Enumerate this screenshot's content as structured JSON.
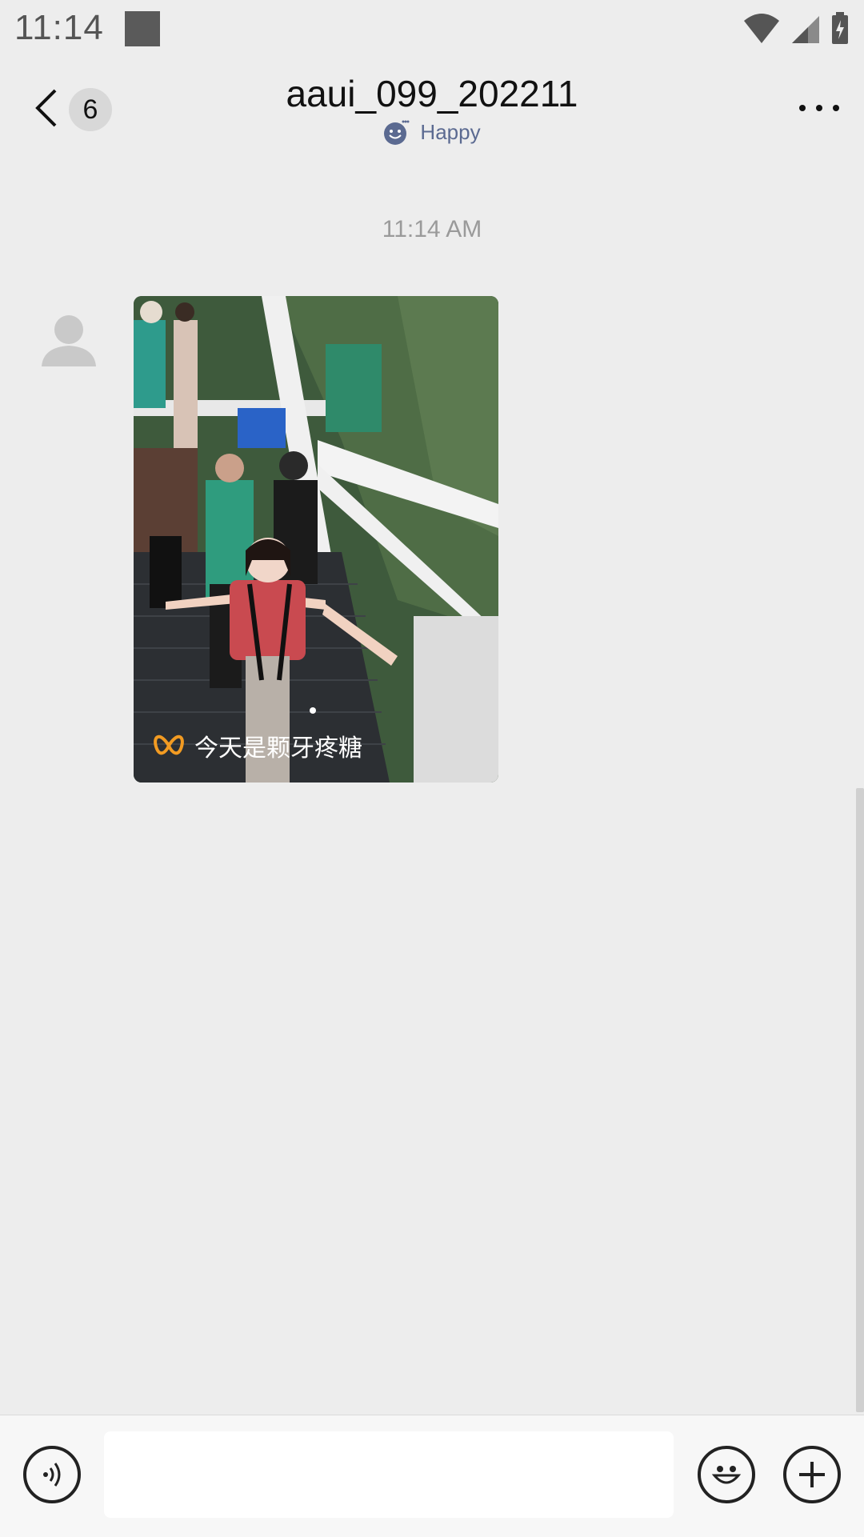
{
  "status_bar": {
    "time": "11:14"
  },
  "header": {
    "unread_count": "6",
    "title": "aaui_099_202211",
    "status_text": "Happy",
    "status_color": "#5b6a91"
  },
  "chat": {
    "timestamp": "11:14 AM",
    "messages": [
      {
        "type": "image",
        "caption": "今天是颗牙疼糖"
      }
    ]
  },
  "input_bar": {
    "placeholder": ""
  },
  "icons": {
    "back": "chevron-left-icon",
    "more": "more-horizontal-icon",
    "avatar": "user-placeholder-icon",
    "voice": "voice-icon",
    "emoji": "emoji-smile-icon",
    "plus": "plus-circle-icon",
    "caption_logo": "butterfly-logo-icon"
  }
}
